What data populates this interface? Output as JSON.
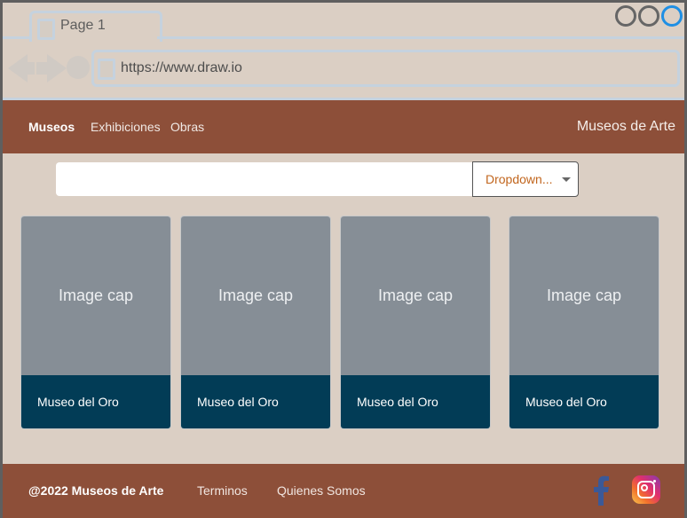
{
  "browser": {
    "tab_label": "Page 1",
    "url": "https://www.draw.io",
    "accent_color": "#1f8fe4"
  },
  "navbar": {
    "links": [
      "Museos",
      "Exhibiciones",
      "Obras"
    ],
    "brand": "Museos de Arte",
    "background_color": "#8d4f39"
  },
  "search": {
    "value": "",
    "dropdown_label": "Dropdown..."
  },
  "cards": [
    {
      "image_label": "Image cap",
      "title": "Museo del Oro"
    },
    {
      "image_label": "Image cap",
      "title": "Museo del Oro"
    },
    {
      "image_label": "Image cap",
      "title": "Museo del Oro"
    },
    {
      "image_label": "Image cap",
      "title": "Museo del Oro"
    }
  ],
  "footer": {
    "copyright": "@2022 Museos de Arte",
    "links": [
      "Terminos",
      "Quienes Somos"
    ],
    "icons": [
      "facebook-icon",
      "instagram-icon"
    ]
  }
}
